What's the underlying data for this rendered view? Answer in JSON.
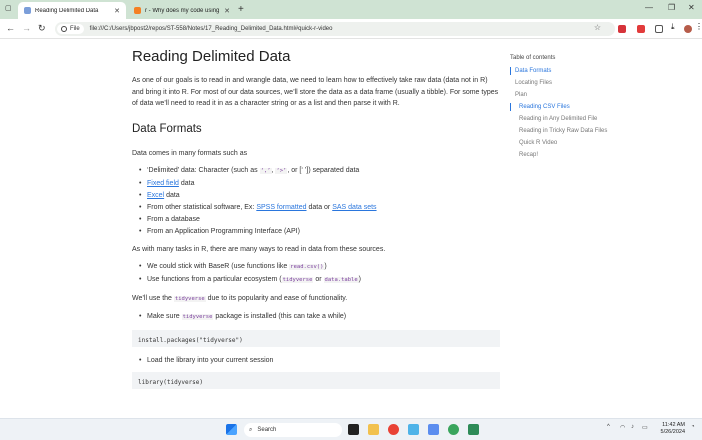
{
  "browser": {
    "tabs": [
      {
        "title": "Reading Delimited Data",
        "active": true
      },
      {
        "title": "r - Why does my code using read...",
        "active": false
      }
    ],
    "file_label": "File",
    "url": "file:///C:/Users/jbpost2/repos/ST-558/Notes/17_Reading_Delimited_Data.html#quick-r-video",
    "accent": "#2a76dd"
  },
  "article": {
    "title": "Reading Delimited Data",
    "intro": "As one of our goals is to read in and wrangle data, we need to learn how to effectively take raw data (data not in R) and bring it into R. For most of our data sources, we’ll store the data as a data frame (usually a tibble). For some types of data we’ll need to read it in as a character string or as a list and then parse it with R.",
    "section_title": "Data Formats",
    "formats_intro": "Data comes in many formats such as",
    "formats": {
      "delim_a": "‘Delimited’ data: Character (such as ",
      "delim_code1": "‘,’",
      "delim_b": ", ",
      "delim_code2": "‘>’",
      "delim_c": ", or [‘ ’]) separated data",
      "fixed_link": "Fixed field",
      "fixed_rest": " data",
      "excel_link": "Excel",
      "excel_rest": " data",
      "other_a": "From other statistical software, Ex: ",
      "spss_link": "SPSS formatted",
      "other_b": " data or ",
      "sas_link": "SAS data sets",
      "database": "From a database",
      "api": "From an Application Programming Interface (API)"
    },
    "ways_intro": "As with many tasks in R, there are many ways to read in data from these sources.",
    "ways": {
      "baser_a": "We could stick with BaseR (use functions like ",
      "baser_code": "read.csv()",
      "baser_b": ")",
      "eco_a": "Use functions from a particular ecosystem (",
      "eco_code1": "tidyverse",
      "eco_b": " or ",
      "eco_code2": "data.table",
      "eco_c": ")"
    },
    "use_a": "We’ll use the ",
    "use_code": "tidyverse",
    "use_b": " due to its popularity and ease of functionality.",
    "install_a": "Make sure ",
    "install_code": "tidyverse",
    "install_b": " package is installed (this can take a while)",
    "install_block": "install.packages(\"tidyverse\")",
    "load_text": "Load the library into your current session",
    "load_block": "library(tidyverse)"
  },
  "toc": {
    "title": "Table of contents",
    "items": [
      {
        "label": "Data Formats",
        "active": true
      },
      {
        "label": "Locating Files"
      },
      {
        "label": "Plan"
      },
      {
        "label": "Reading CSV Files",
        "active": true
      },
      {
        "label": "Reading in Any Delimited File"
      },
      {
        "label": "Reading in Tricky Raw Data Files"
      },
      {
        "label": "Quick R Video"
      },
      {
        "label": "Recap!"
      }
    ]
  },
  "taskbar": {
    "search_placeholder": "Search",
    "time": "11:42 AM",
    "date": "5/26/2024"
  }
}
